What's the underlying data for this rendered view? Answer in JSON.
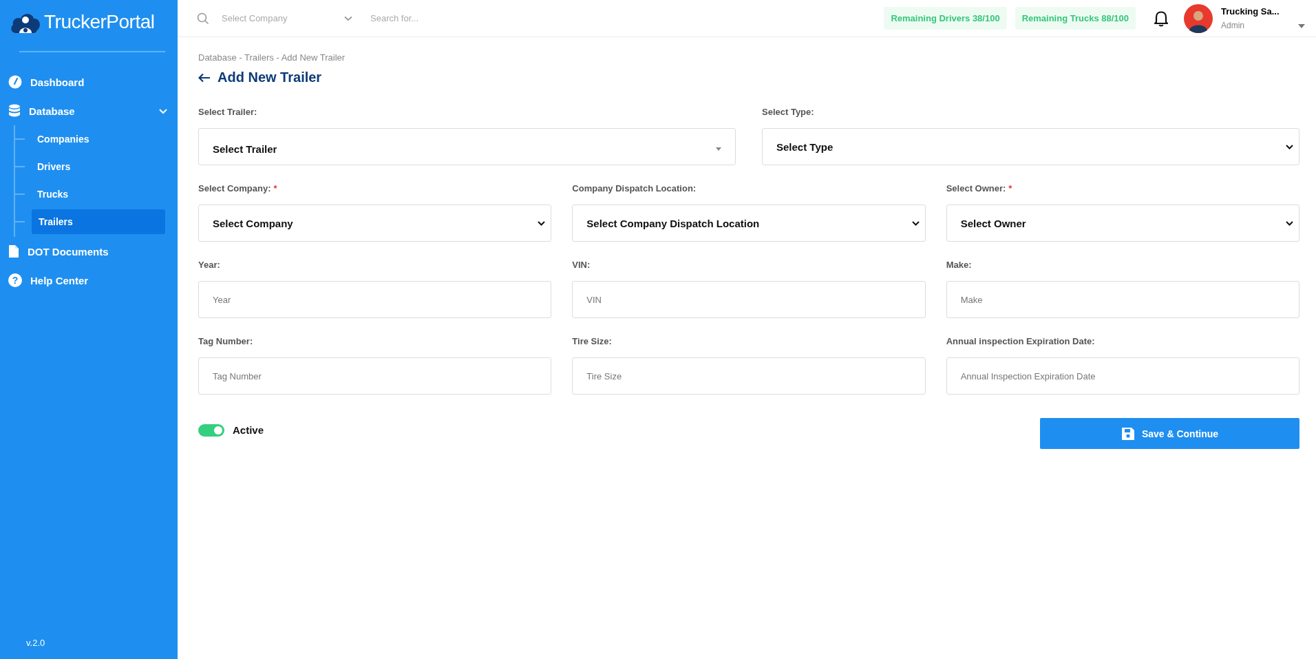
{
  "sidebar": {
    "logo": "TruckerPortal",
    "items": [
      {
        "label": "Dashboard",
        "selected": false
      },
      {
        "label": "Database",
        "selected": false,
        "expanded": true,
        "children": [
          {
            "label": "Companies",
            "selected": false
          },
          {
            "label": "Drivers",
            "selected": false
          },
          {
            "label": "Trucks",
            "selected": false
          },
          {
            "label": "Trailers",
            "selected": true
          }
        ]
      },
      {
        "label": "DOT Documents",
        "selected": false
      },
      {
        "label": "Help Center",
        "selected": false,
        "icon_text": "?"
      }
    ],
    "version": "v.2.0"
  },
  "topbar": {
    "company_select": {
      "placeholder": "Select Company"
    },
    "search": {
      "placeholder": "Search for..."
    },
    "badges": [
      "Remaining Drivers 38/100",
      "Remaining Trucks 88/100"
    ],
    "user": {
      "name": "Trucking Sa...",
      "role": "Admin"
    }
  },
  "breadcrumb": "Database - Trailers - Add New Trailer",
  "page_title": "Add New Trailer",
  "form": {
    "rows": [
      [
        {
          "label": "Select Trailer:",
          "kind": "dropdown",
          "value": "Select Trailer"
        },
        {
          "label": "Select Type:",
          "kind": "select",
          "value": "Select Type"
        }
      ],
      [
        {
          "label": "Select Company:",
          "required_mark": "*",
          "kind": "select",
          "value": "Select Company"
        },
        {
          "label": "Company Dispatch Location:",
          "kind": "select",
          "value": "Select Company Dispatch Location"
        },
        {
          "label": "Select Owner:",
          "required_mark": "*",
          "kind": "select",
          "value": "Select Owner"
        }
      ],
      [
        {
          "label": "Year:",
          "kind": "input",
          "placeholder": "Year"
        },
        {
          "label": "VIN:",
          "kind": "input",
          "placeholder": "VIN"
        },
        {
          "label": "Make:",
          "kind": "input",
          "placeholder": "Make"
        }
      ],
      [
        {
          "label": "Tag Number:",
          "kind": "input",
          "placeholder": "Tag Number"
        },
        {
          "label": "Tire Size:",
          "kind": "input",
          "placeholder": "Tire Size"
        },
        {
          "label": "Annual inspection Expiration Date:",
          "kind": "input",
          "placeholder": "Annual Inspection Expiration Date"
        }
      ]
    ],
    "active": {
      "label": "Active",
      "on": true
    },
    "save_button": "Save & Continue"
  }
}
